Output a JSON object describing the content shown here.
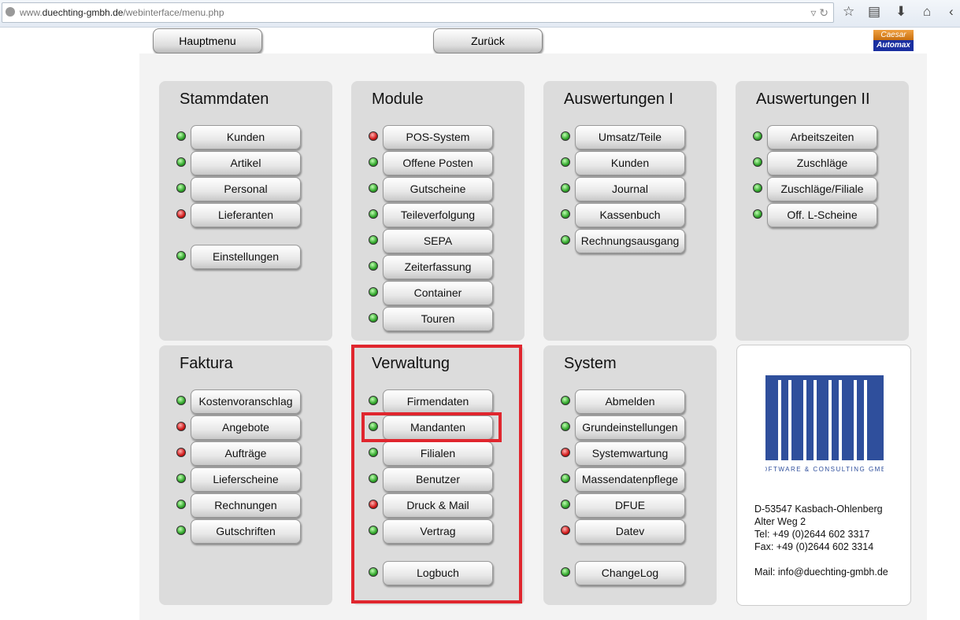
{
  "browser": {
    "url_prefix": "www.",
    "url_domain": "duechting-gmbh.de",
    "url_path": "/webinterface/menu.php"
  },
  "top": {
    "hauptmenu": "Hauptmenu",
    "zurueck": "Zurück",
    "logo_top": "Caesar",
    "logo_bottom": "Automax"
  },
  "accent": "#e0262e",
  "panels": [
    {
      "title": "Stammdaten",
      "items": [
        {
          "label": "Kunden",
          "status": "green"
        },
        {
          "label": "Artikel",
          "status": "green"
        },
        {
          "label": "Personal",
          "status": "green"
        },
        {
          "label": "Lieferanten",
          "status": "red"
        },
        {
          "label": "Einstellungen",
          "status": "green",
          "gap": true
        }
      ]
    },
    {
      "title": "Module",
      "items": [
        {
          "label": "POS-System",
          "status": "red"
        },
        {
          "label": "Offene Posten",
          "status": "green"
        },
        {
          "label": "Gutscheine",
          "status": "green"
        },
        {
          "label": "Teileverfolgung",
          "status": "green"
        },
        {
          "label": "SEPA",
          "status": "green"
        },
        {
          "label": "Zeiterfassung",
          "status": "green"
        },
        {
          "label": "Container",
          "status": "green"
        },
        {
          "label": "Touren",
          "status": "green"
        }
      ]
    },
    {
      "title": "Auswertungen I",
      "items": [
        {
          "label": "Umsatz/Teile",
          "status": "green"
        },
        {
          "label": "Kunden",
          "status": "green"
        },
        {
          "label": "Journal",
          "status": "green"
        },
        {
          "label": "Kassenbuch",
          "status": "green"
        },
        {
          "label": "Rechnungsausgang",
          "status": "green"
        }
      ]
    },
    {
      "title": "Auswertungen II",
      "items": [
        {
          "label": "Arbeitszeiten",
          "status": "green"
        },
        {
          "label": "Zuschläge",
          "status": "green"
        },
        {
          "label": "Zuschläge/Filiale",
          "status": "green"
        },
        {
          "label": "Off. L-Scheine",
          "status": "green"
        }
      ]
    },
    {
      "title": "Faktura",
      "items": [
        {
          "label": "Kostenvoranschlag",
          "status": "green"
        },
        {
          "label": "Angebote",
          "status": "red"
        },
        {
          "label": "Aufträge",
          "status": "red"
        },
        {
          "label": "Lieferscheine",
          "status": "green"
        },
        {
          "label": "Rechnungen",
          "status": "green"
        },
        {
          "label": "Gutschriften",
          "status": "green"
        }
      ]
    },
    {
      "title": "Verwaltung",
      "highlighted": true,
      "items": [
        {
          "label": "Firmendaten",
          "status": "green"
        },
        {
          "label": "Mandanten",
          "status": "green",
          "highlighted": true
        },
        {
          "label": "Filialen",
          "status": "green"
        },
        {
          "label": "Benutzer",
          "status": "green"
        },
        {
          "label": "Druck & Mail",
          "status": "red"
        },
        {
          "label": "Vertrag",
          "status": "green"
        },
        {
          "label": "Logbuch",
          "status": "green",
          "gap": true
        }
      ]
    },
    {
      "title": "System",
      "items": [
        {
          "label": "Abmelden",
          "status": "green"
        },
        {
          "label": "Grundeinstellungen",
          "status": "green"
        },
        {
          "label": "Systemwartung",
          "status": "red"
        },
        {
          "label": "Massendatenpflege",
          "status": "green"
        },
        {
          "label": "DFUE",
          "status": "green"
        },
        {
          "label": "Datev",
          "status": "red"
        },
        {
          "label": "ChangeLog",
          "status": "green",
          "gap": true
        }
      ]
    }
  ],
  "company": {
    "logo_name": "DÜCHTING",
    "logo_sub": "SOFTWARE & CONSULTING GMBH",
    "address": [
      "D-53547 Kasbach-Ohlenberg",
      "Alter Weg 2",
      "Tel: +49 (0)2644 602 3317",
      "Fax: +49 (0)2644 602 3314",
      "",
      "Mail: info@duechting-gmbh.de"
    ]
  }
}
